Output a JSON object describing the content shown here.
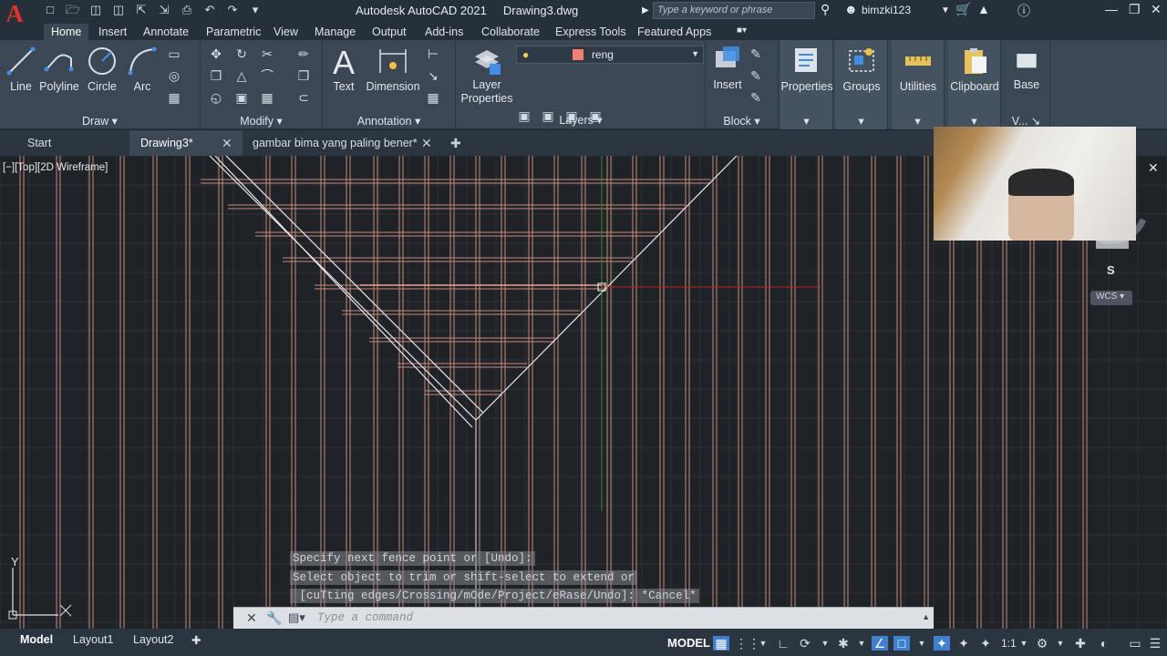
{
  "titlebar": {
    "app_title": "Autodesk AutoCAD 2021",
    "file_name": "Drawing3.dwg",
    "search_placeholder": "Type a keyword or phrase",
    "user": "bimzki123"
  },
  "ribbon_tabs": [
    "Home",
    "Insert",
    "Annotate",
    "Parametric",
    "View",
    "Manage",
    "Output",
    "Add-ins",
    "Collaborate",
    "Express Tools",
    "Featured Apps"
  ],
  "ribbon": {
    "draw": {
      "title": "Draw",
      "tools": [
        "Line",
        "Polyline",
        "Circle",
        "Arc"
      ]
    },
    "modify": {
      "title": "Modify"
    },
    "annotation": {
      "title": "Annotation",
      "tools": [
        "Text",
        "Dimension"
      ]
    },
    "layers": {
      "title": "Layers",
      "layer_properties": "Layer Properties",
      "current_layer": "reng",
      "layer_color": "#f08070"
    },
    "block": {
      "title": "Block",
      "insert": "Insert"
    },
    "properties": "Properties",
    "groups": "Groups",
    "utilities": "Utilities",
    "clipboard": "Clipboard",
    "base": "Base",
    "view_short": "V..."
  },
  "doc_tabs": [
    "Start",
    "Drawing3*",
    "gambar bima yang paling bener*"
  ],
  "viewport": {
    "label": "[−][Top][2D Wireframe]",
    "viewcube_east": "E",
    "viewcube_south": "S",
    "wcs": "WCS",
    "ucs_y": "Y"
  },
  "command": {
    "history": [
      "Specify next fence point or [Undo]:",
      "Select object to trim or shift-select to extend or",
      " [cuTting edges/Crossing/mOde/Project/eRase/Undo]: *Cancel*"
    ],
    "placeholder": "Type a command"
  },
  "layout_tabs": [
    "Model",
    "Layout1",
    "Layout2"
  ],
  "status": {
    "mode": "MODEL",
    "scale": "1:1"
  }
}
